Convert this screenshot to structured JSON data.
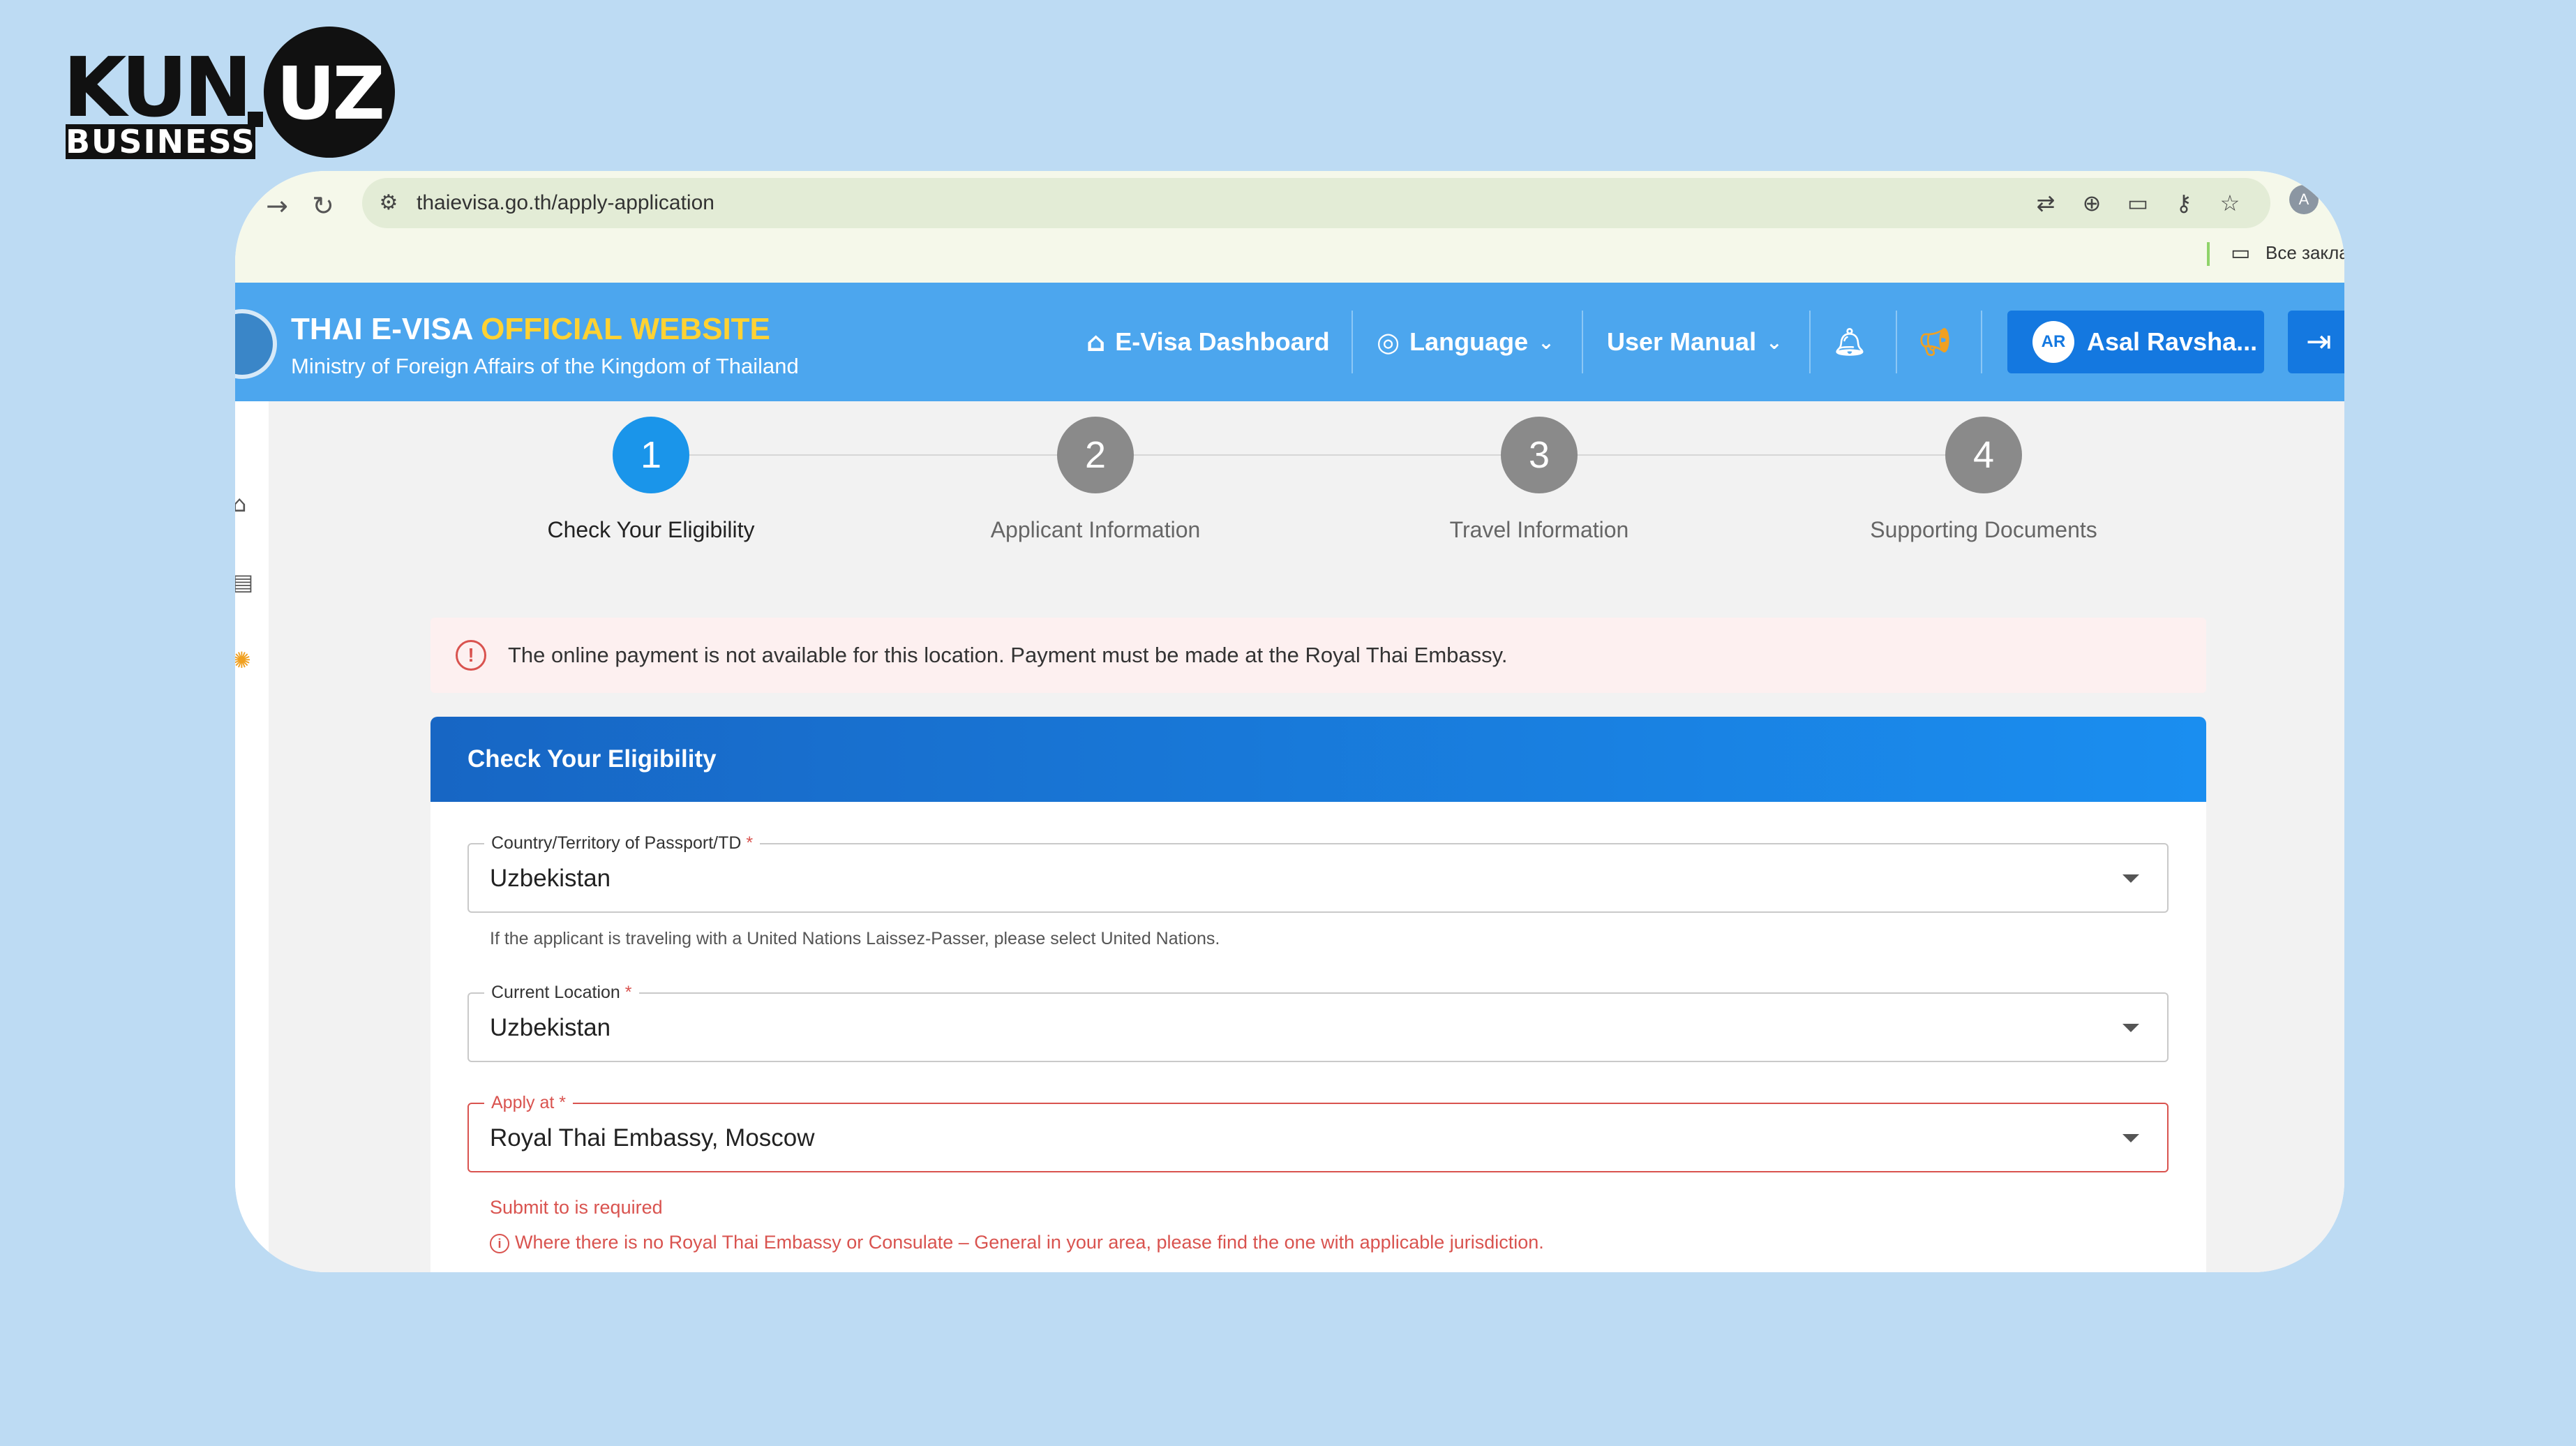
{
  "logo": {
    "main": "KUN",
    "dot": ".",
    "suffix": "UZ",
    "tag": "BUSINESS"
  },
  "browser": {
    "url": "thaievisa.go.th/apply-application",
    "profile_initial": "A",
    "bookmark_label": "Все заклад",
    "icons": [
      "arrow-right-icon",
      "reload-icon",
      "site-settings-icon",
      "translate-icon",
      "zoom-icon",
      "cast-icon",
      "key-icon",
      "star-icon"
    ]
  },
  "header": {
    "title_part1": "THAI E-VISA ",
    "title_part2": "OFFICIAL WEBSITE",
    "subtitle": "Ministry of Foreign Affairs of the Kingdom of Thailand",
    "nav": {
      "dashboard": "E-Visa Dashboard",
      "language": "Language",
      "user_manual": "User Manual"
    },
    "user": {
      "initials": "AR",
      "name": "Asal Ravsha..."
    }
  },
  "steps": [
    {
      "number": "1",
      "label": "Check Your Eligibility",
      "active": true
    },
    {
      "number": "2",
      "label": "Applicant Information",
      "active": false
    },
    {
      "number": "3",
      "label": "Travel Information",
      "active": false
    },
    {
      "number": "4",
      "label": "Supporting Documents",
      "active": false
    }
  ],
  "alert": {
    "icon": "!",
    "text": "The online payment is not available for this location. Payment must be made at the Royal Thai Embassy."
  },
  "form": {
    "title": "Check Your Eligibility",
    "passport_country": {
      "label": "Country/Territory of Passport/TD",
      "required": "*",
      "value": "Uzbekistan",
      "hint": "If the applicant is traveling with a United Nations Laissez-Passer, please select United Nations."
    },
    "current_location": {
      "label": "Current Location",
      "required": "*",
      "value": "Uzbekistan"
    },
    "apply_at": {
      "label": "Apply at",
      "required": "*",
      "value": "Royal Thai Embassy, Moscow",
      "error": "Submit to is required",
      "info": "Where there is no Royal Thai Embassy or Consulate – General in your area, please find the one with applicable jurisdiction."
    }
  },
  "colors": {
    "page_bg": "#bddbf3",
    "header_bg": "#4ca6ee",
    "title_accent": "#ffd233",
    "primary": "#1478e0",
    "step_active": "#1a95ea",
    "error": "#d9534f"
  }
}
